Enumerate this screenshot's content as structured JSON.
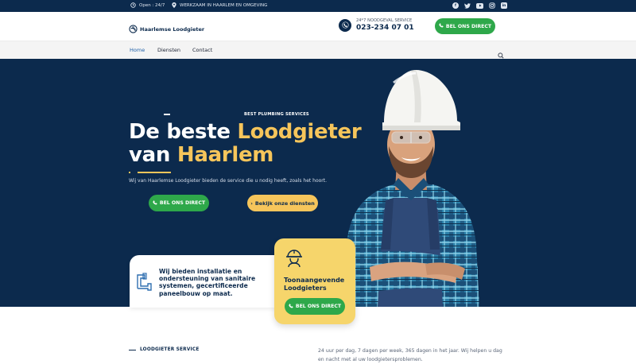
{
  "topbar": {
    "open_text": "Open : 24/7",
    "location_text": "WERKZAAM IN HAARLEM EN OMGEVING",
    "socials": [
      "facebook-icon",
      "twitter-icon",
      "youtube-icon",
      "instagram-icon",
      "linkedin-icon"
    ]
  },
  "header": {
    "logo_text": "Haarlemse Loodgieter",
    "emergency_label": "24*7 NOODGEVAL SERVICE",
    "emergency_phone": "023-234 07 01",
    "cta_label": "BEL ONS DIRECT"
  },
  "nav": {
    "items": [
      "Home",
      "Diensten",
      "Contact"
    ],
    "active": "Home"
  },
  "hero": {
    "eyebrow": "BEST PLUMBING SERVICES",
    "title_line1_a": "De beste ",
    "title_line1_b": "Loodgieter",
    "title_line2_a": "van ",
    "title_line2_b": "Haarlem",
    "subtitle": "Wij van Haarlemse Loodgieter bieden de service die u nodig heeft, zoals het hoort.",
    "btn_primary": "BEL ONS DIRECT",
    "btn_secondary": "Bekijk onze diensten"
  },
  "cards": {
    "white_text": "Wij bieden installatie en ondersteuning van sanitaire systemen, gecertificeerde paneelbouw op maat.",
    "yellow_title": "Toonaangevende Loodgieters",
    "yellow_btn": "BEL ONS DIRECT"
  },
  "below": {
    "label": "LOODGIETER SERVICE",
    "text": "24 uur per dag, 7 dagen per week, 365 dagen in het jaar. Wij helpen u dag en nacht met al uw loodgietersproblemen."
  },
  "colors": {
    "navy": "#0c2a4d",
    "accent_yellow": "#f6c55b",
    "green": "#2ea84a"
  }
}
